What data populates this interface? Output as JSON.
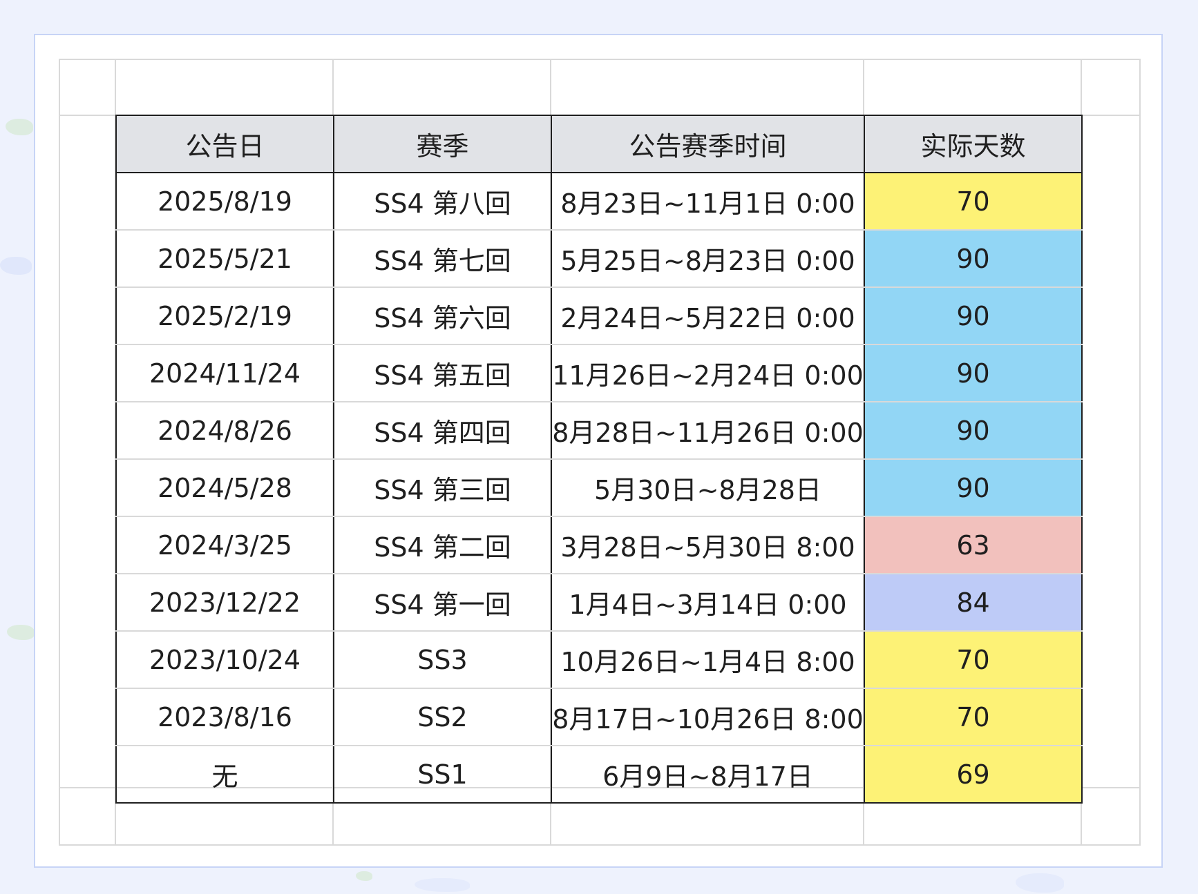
{
  "table": {
    "headers": [
      "公告日",
      "赛季",
      "公告赛季时间",
      "实际天数"
    ],
    "rows": [
      {
        "date": "2025/8/19",
        "season": "SS4 第八回",
        "period": "8月23日~11月1日 0:00",
        "days": "70",
        "color": "#fdf276"
      },
      {
        "date": "2025/5/21",
        "season": "SS4 第七回",
        "period": "5月25日~8月23日 0:00",
        "days": "90",
        "color": "#92d6f5"
      },
      {
        "date": "2025/2/19",
        "season": "SS4 第六回",
        "period": "2月24日~5月22日 0:00",
        "days": "90",
        "color": "#92d6f5"
      },
      {
        "date": "2024/11/24",
        "season": "SS4 第五回",
        "period": "11月26日~2月24日 0:00",
        "days": "90",
        "color": "#92d6f5"
      },
      {
        "date": "2024/8/26",
        "season": "SS4 第四回",
        "period": "8月28日~11月26日 0:00",
        "days": "90",
        "color": "#92d6f5"
      },
      {
        "date": "2024/5/28",
        "season": "SS4 第三回",
        "period": "5月30日~8月28日",
        "days": "90",
        "color": "#92d6f5"
      },
      {
        "date": "2024/3/25",
        "season": "SS4 第二回",
        "period": "3月28日~5月30日 8:00",
        "days": "63",
        "color": "#f2c1bd"
      },
      {
        "date": "2023/12/22",
        "season": "SS4 第一回",
        "period": "1月4日~3月14日 0:00",
        "days": "84",
        "color": "#becbf7"
      },
      {
        "date": "2023/10/24",
        "season": "SS3",
        "period": "10月26日~1月4日 8:00",
        "days": "70",
        "color": "#fdf276"
      },
      {
        "date": "2023/8/16",
        "season": "SS2",
        "period": "8月17日~10月26日 8:00",
        "days": "70",
        "color": "#fdf276"
      },
      {
        "date": "无",
        "season": "SS1",
        "period": "6月9日~8月17日",
        "days": "69",
        "color": "#fdf276"
      }
    ]
  }
}
